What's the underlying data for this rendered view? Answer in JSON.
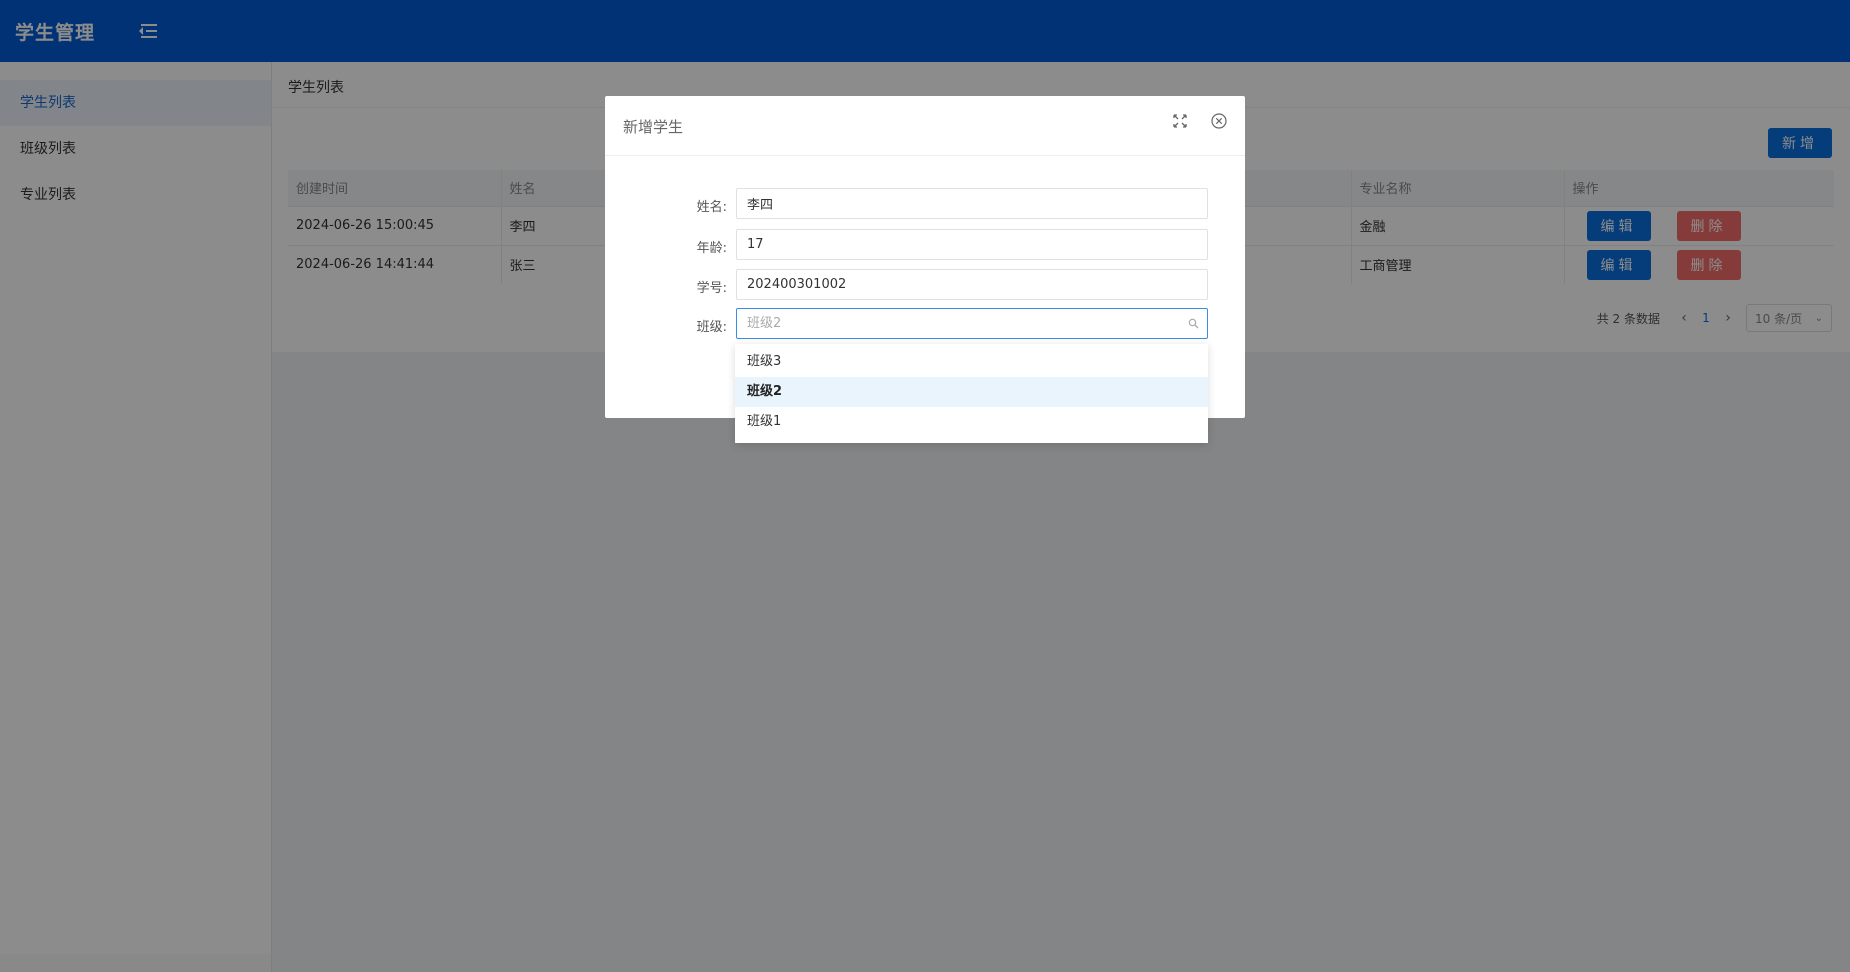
{
  "header": {
    "title": "学生管理",
    "menu_icon": "menu-fold-icon"
  },
  "sidebar": {
    "items": [
      {
        "label": "学生列表",
        "active": true
      },
      {
        "label": "班级列表",
        "active": false
      },
      {
        "label": "专业列表",
        "active": false
      }
    ]
  },
  "breadcrumb": "学生列表",
  "toolbar": {
    "add_label": "新增"
  },
  "table": {
    "columns": [
      "创建时间",
      "姓名",
      "专业名称",
      "操作"
    ],
    "rows": [
      {
        "created": "2024-06-26 15:00:45",
        "name": "李四",
        "major": "金融"
      },
      {
        "created": "2024-06-26 14:41:44",
        "name": "张三",
        "major": "工商管理"
      }
    ],
    "edit_label": "编辑",
    "delete_label": "删除"
  },
  "pagination": {
    "total": "共 2 条数据",
    "current_page": "1",
    "page_size": "10 条/页"
  },
  "dialog": {
    "title": "新增学生",
    "fields": {
      "name": {
        "label": "姓名:",
        "value": "李四"
      },
      "age": {
        "label": "年龄:",
        "value": "17"
      },
      "student_no": {
        "label": "学号:",
        "value": "202400301002"
      },
      "class": {
        "label": "班级:",
        "placeholder": "班级2"
      }
    }
  },
  "dropdown": {
    "options": [
      "班级3",
      "班级2",
      "班级1"
    ],
    "selected": "班级2"
  },
  "colors": {
    "primary": "#005bd6",
    "button": "#0a6fe0",
    "danger": "#f56c6c"
  }
}
